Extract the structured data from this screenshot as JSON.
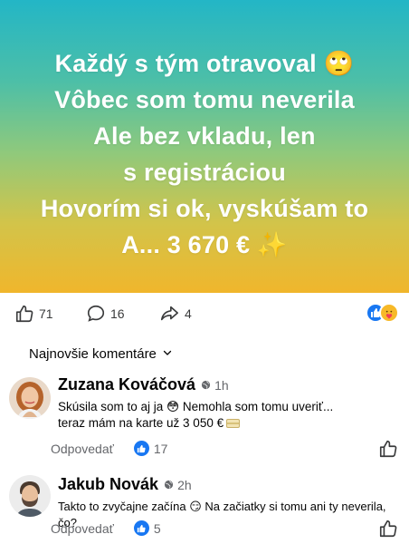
{
  "post": {
    "lines": [
      "Každý s tým otravoval 🙄",
      "Vôbec som tomu neverila",
      "Ale bez vkladu, len",
      "s registráciou",
      "Hovorím si ok, vyskúšam to",
      "A... 3 670 € ✨"
    ],
    "gradient_colors": [
      "#23b6c6",
      "#8fc97c",
      "#f0b62c"
    ]
  },
  "actions": {
    "likes": "71",
    "comments": "16",
    "shares": "4",
    "reaction_icons": [
      "like-icon",
      "care-icon"
    ]
  },
  "sort": {
    "label": "Najnovšie komentáre"
  },
  "comments": [
    {
      "name": "Zuzana Kováčová",
      "time": "1h",
      "text_line1": "Skúsila som to aj ja 😳 Nemohla som tomu uveriť...",
      "text_line2": "teraz mám na karte už 3 050 €",
      "reply_label": "Odpovedať",
      "likes": "17"
    },
    {
      "name": "Jakub Novák",
      "time": "2h",
      "text_line1": "Takto to zvyčajne začína 😏 Na začiatky si tomu ani ty neverila, čo?",
      "reply_label": "Odpovedať",
      "likes": "5"
    }
  ],
  "colors": {
    "accent": "#1877f2",
    "muted": "#65676b",
    "text": "#050505"
  }
}
